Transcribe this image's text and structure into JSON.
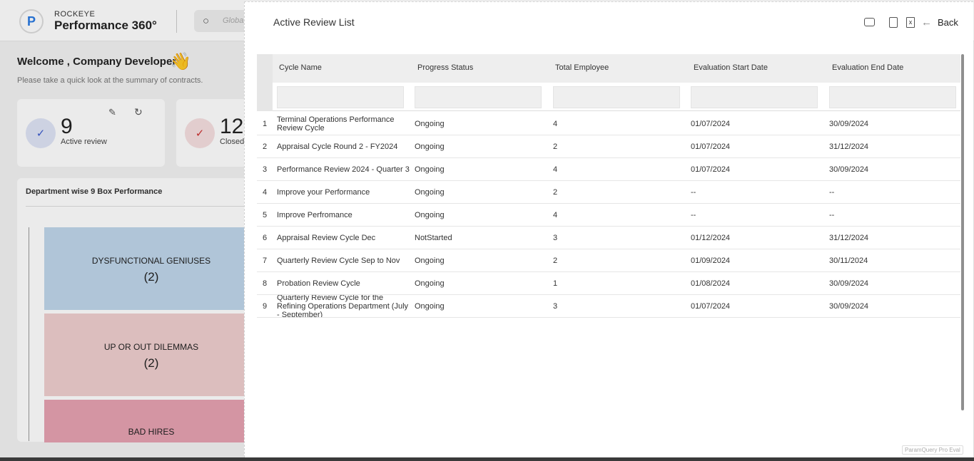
{
  "brand": {
    "small": "ROCKEYE",
    "big": "Performance 360°"
  },
  "global_search": {
    "placeholder": "Global"
  },
  "welcome": {
    "title": "Welcome , Company Developer",
    "subtitle": "Please take a quick look at the summary of contracts."
  },
  "cards": [
    {
      "value": "9",
      "label": "Active review"
    },
    {
      "value": "12",
      "label": "Closed"
    }
  ],
  "nine_box": {
    "title": "Department wise 9 Box Performance",
    "boxes": [
      {
        "label": "DYSFUNCTIONAL GENIUSES",
        "count": "(2)"
      },
      {
        "label": "UP OR OUT DILEMMAS",
        "count": "(2)"
      },
      {
        "label": "BAD HIRES",
        "count": ""
      }
    ]
  },
  "modal": {
    "title": "Active Review List",
    "back_label": "Back",
    "tool_icons": [
      "mail-icon",
      "clipboard-icon",
      "excel-icon",
      "arrow-left-icon"
    ],
    "watermark": "ParamQuery Pro Eval"
  },
  "table": {
    "columns": [
      "Cycle Name",
      "Progress Status",
      "Total Employee",
      "Evaluation Start Date",
      "Evaluation End Date"
    ],
    "rows": [
      {
        "num": "1",
        "name": "Terminal Operations Performance Review Cycle",
        "status": "Ongoing",
        "employees": "4",
        "start": "01/07/2024",
        "end": "30/09/2024"
      },
      {
        "num": "2",
        "name": "Appraisal Cycle Round 2 - FY2024",
        "status": "Ongoing",
        "employees": "2",
        "start": "01/07/2024",
        "end": "31/12/2024"
      },
      {
        "num": "3",
        "name": "Performance Review 2024 - Quarter 3",
        "status": "Ongoing",
        "employees": "4",
        "start": "01/07/2024",
        "end": "30/09/2024"
      },
      {
        "num": "4",
        "name": "Improve your Performance",
        "status": "Ongoing",
        "employees": "2",
        "start": "--",
        "end": "--"
      },
      {
        "num": "5",
        "name": "Improve Perfromance",
        "status": "Ongoing",
        "employees": "4",
        "start": "--",
        "end": "--"
      },
      {
        "num": "6",
        "name": "Appraisal Review Cycle Dec",
        "status": "NotStarted",
        "employees": "3",
        "start": "01/12/2024",
        "end": "31/12/2024"
      },
      {
        "num": "7",
        "name": "Quarterly Review Cycle Sep to Nov",
        "status": "Ongoing",
        "employees": "2",
        "start": "01/09/2024",
        "end": "30/11/2024"
      },
      {
        "num": "8",
        "name": "Probation Review Cycle",
        "status": "Ongoing",
        "employees": "1",
        "start": "01/08/2024",
        "end": "30/09/2024"
      },
      {
        "num": "9",
        "name": "Quarterly Review Cycle for the Refining Operations Department (July - September)",
        "status": "Ongoing",
        "employees": "3",
        "start": "01/07/2024",
        "end": "30/09/2024"
      }
    ]
  }
}
